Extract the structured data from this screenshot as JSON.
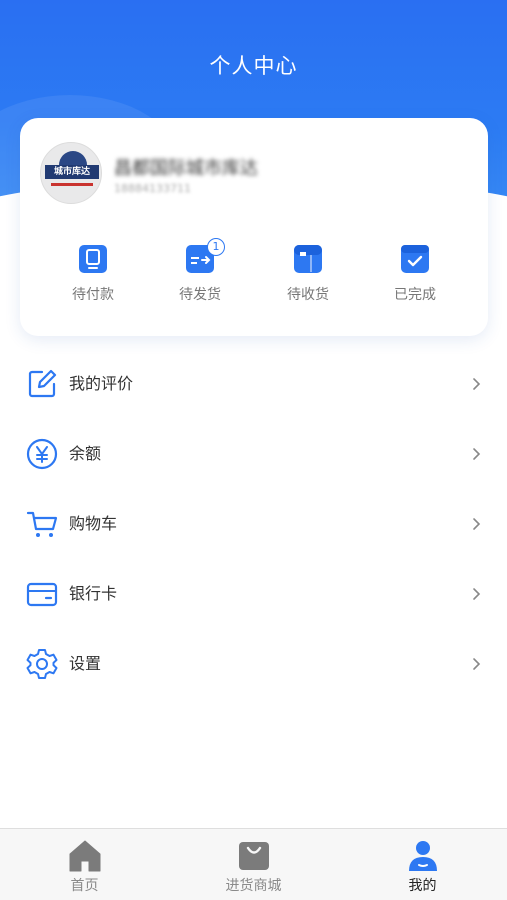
{
  "header": {
    "title": "个人中心"
  },
  "profile": {
    "avatar_text": "城市库达",
    "name": "昌都国际城市库达",
    "phone": "18884133711"
  },
  "orders": [
    {
      "label": "待付款",
      "icon": "wallet-icon"
    },
    {
      "label": "待发货",
      "icon": "shipping-card-icon",
      "badge": "1"
    },
    {
      "label": "待收货",
      "icon": "package-box-icon"
    },
    {
      "label": "已完成",
      "icon": "check-box-icon"
    }
  ],
  "menu": [
    {
      "label": "我的评价",
      "icon": "edit-icon"
    },
    {
      "label": "余额",
      "icon": "yen-icon"
    },
    {
      "label": "购物车",
      "icon": "cart-icon"
    },
    {
      "label": "银行卡",
      "icon": "bank-card-icon"
    },
    {
      "label": "设置",
      "icon": "gear-icon"
    }
  ],
  "tabbar": {
    "items": [
      {
        "label": "首页",
        "icon": "home-icon",
        "active": false
      },
      {
        "label": "进货商城",
        "icon": "shopping-bag-icon",
        "active": false
      },
      {
        "label": "我的",
        "icon": "user-icon",
        "active": true
      }
    ]
  },
  "colors": {
    "accent": "#2d78f2",
    "header_top": "#2a6ff2",
    "inactive_tab": "#8a8a8a"
  }
}
